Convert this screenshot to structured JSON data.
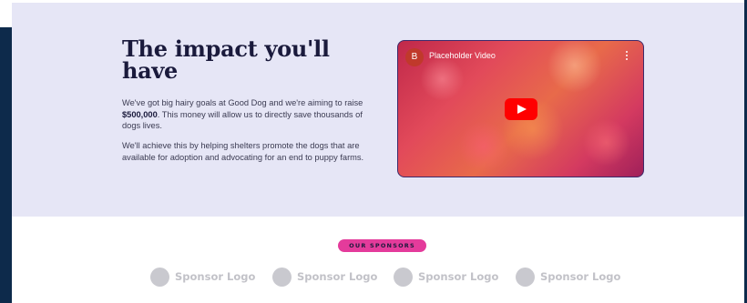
{
  "impact": {
    "title": "The impact you'll have",
    "paragraph1_start": "We've got big hairy goals at Good Dog and we're aiming to raise ",
    "paragraph1_amount": "$500,000",
    "paragraph1_end": ". This money will allow us to directly save thousands of dogs lives.",
    "paragraph2": "We'll achieve this by helping shelters promote the dogs that are available for adoption and advocating for an end to puppy farms."
  },
  "video": {
    "avatar_letter": "B",
    "title": "Placeholder Video",
    "play_icon": "youtube-play-icon",
    "menu_icon": "kebab-menu-icon"
  },
  "sponsors": {
    "badge": "OUR SPONSORS",
    "items": [
      {
        "label": "Sponsor Logo"
      },
      {
        "label": "Sponsor Logo"
      },
      {
        "label": "Sponsor Logo"
      },
      {
        "label": "Sponsor Logo"
      }
    ]
  },
  "colors": {
    "impact_background": "#e6e6f6",
    "badge": "#e43b9b",
    "dark_frame": "#0d2a4b"
  }
}
